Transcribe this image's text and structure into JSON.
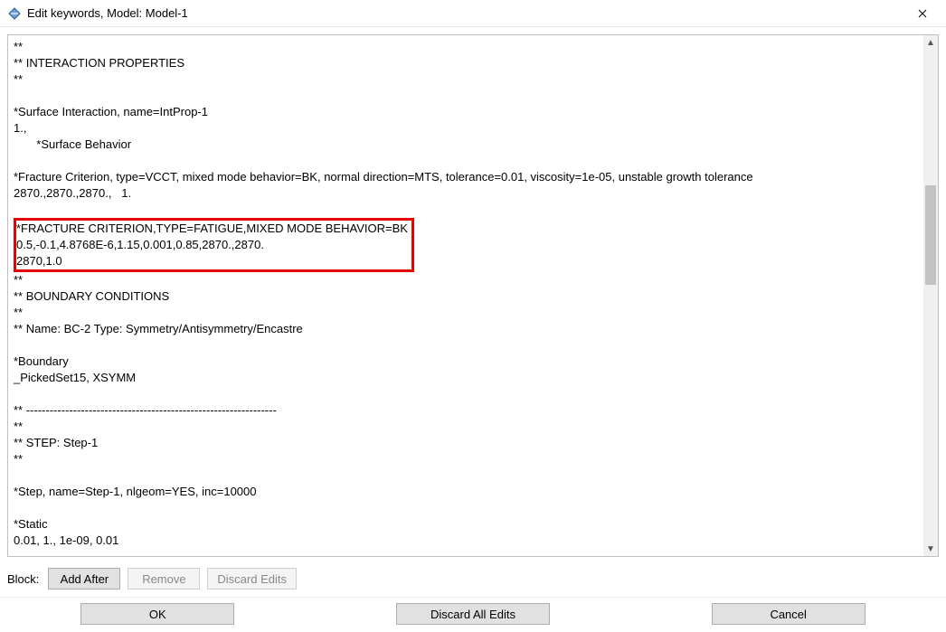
{
  "window": {
    "title": "Edit keywords, Model: Model-1"
  },
  "editor": {
    "lines_before": [
      "**",
      "** INTERACTION PROPERTIES",
      "**",
      "",
      "*Surface Interaction, name=IntProp-1",
      "1.,",
      "       *Surface Behavior",
      "",
      "*Fracture Criterion, type=VCCT, mixed mode behavior=BK, normal direction=MTS, tolerance=0.01, viscosity=1e-05, unstable growth tolerance",
      "2870.,2870.,2870.,   1.",
      ""
    ],
    "lines_highlight": [
      "*FRACTURE CRITERION,TYPE=FATIGUE,MIXED MODE BEHAVIOR=BK",
      "0.5,-0.1,4.8768E-6,1.15,0.001,0.85,2870.,2870.",
      "2870,1.0"
    ],
    "lines_after": [
      "**",
      "** BOUNDARY CONDITIONS",
      "**",
      "** Name: BC-2 Type: Symmetry/Antisymmetry/Encastre",
      "",
      "*Boundary",
      "_PickedSet15, XSYMM",
      "",
      "** ----------------------------------------------------------------",
      "**",
      "** STEP: Step-1",
      "**",
      "",
      "*Step, name=Step-1, nlgeom=YES, inc=10000",
      "",
      "*Static",
      "0.01, 1., 1e-09, 0.01",
      ""
    ]
  },
  "block_row": {
    "label": "Block:",
    "add_after": "Add After",
    "remove": "Remove",
    "discard_edits": "Discard Edits"
  },
  "bottom": {
    "ok": "OK",
    "discard_all": "Discard All Edits",
    "cancel": "Cancel"
  }
}
